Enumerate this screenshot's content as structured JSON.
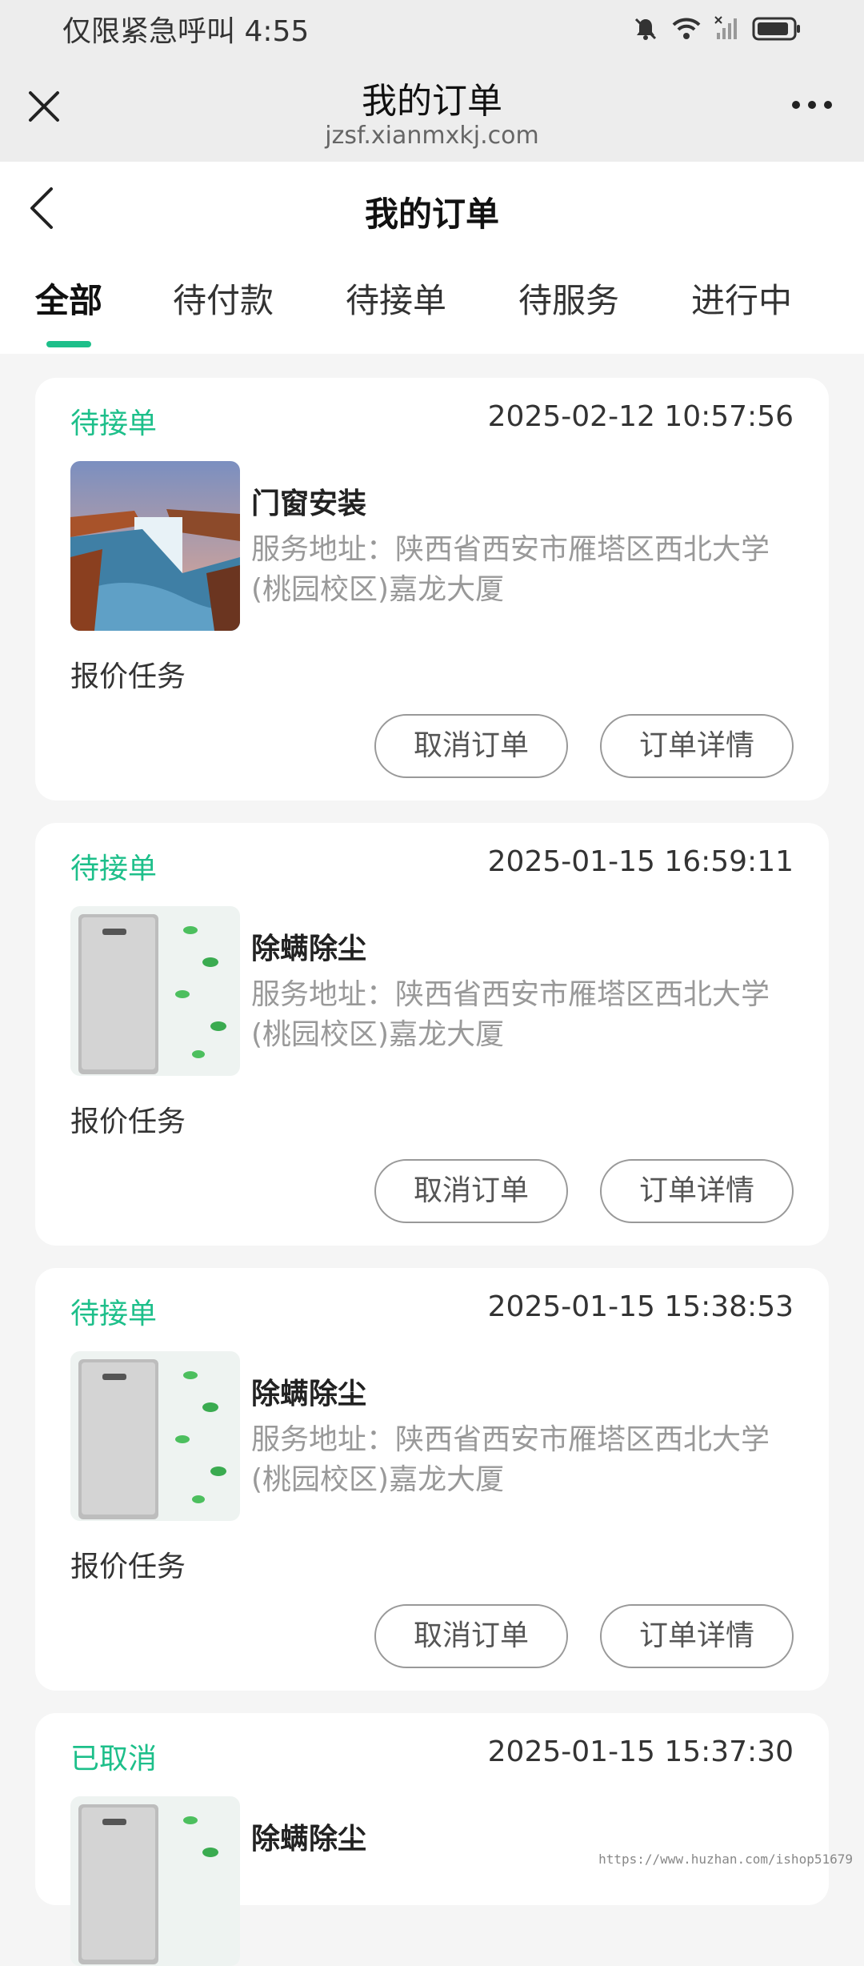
{
  "status_bar": {
    "text": "仅限紧急呼叫 4:55"
  },
  "web_bar": {
    "title": "我的订单",
    "url": "jzsf.xianmxkj.com"
  },
  "app_header": {
    "title": "我的订单"
  },
  "tabs": [
    {
      "label": "全部"
    },
    {
      "label": "待付款"
    },
    {
      "label": "待接单"
    },
    {
      "label": "待服务"
    },
    {
      "label": "进行中"
    }
  ],
  "orders": [
    {
      "status": "待接单",
      "time": "2025-02-12 10:57:56",
      "service": "门窗安装",
      "address": "服务地址：陕西省西安市雁塔区西北大学(桃园校区)嘉龙大厦",
      "task": "报价任务",
      "cancel_label": "取消订单",
      "detail_label": "订单详情",
      "image": "waterfall-photo"
    },
    {
      "status": "待接单",
      "time": "2025-01-15 16:59:11",
      "service": "除螨除尘",
      "address": "服务地址：陕西省西安市雁塔区西北大学(桃园校区)嘉龙大厦",
      "task": "报价任务",
      "cancel_label": "取消订单",
      "detail_label": "订单详情",
      "image": "air-purifier-photo"
    },
    {
      "status": "待接单",
      "time": "2025-01-15 15:38:53",
      "service": "除螨除尘",
      "address": "服务地址：陕西省西安市雁塔区西北大学(桃园校区)嘉龙大厦",
      "task": "报价任务",
      "cancel_label": "取消订单",
      "detail_label": "订单详情",
      "image": "air-purifier-photo"
    },
    {
      "status": "已取消",
      "time": "2025-01-15 15:37:30",
      "service": "除螨除尘",
      "image": "air-purifier-photo"
    }
  ],
  "watermark": "https://www.huzhan.com/ishop51679",
  "colors": {
    "accent": "#1dbf8a",
    "muted": "#999999",
    "background": "#f5f5f5"
  }
}
